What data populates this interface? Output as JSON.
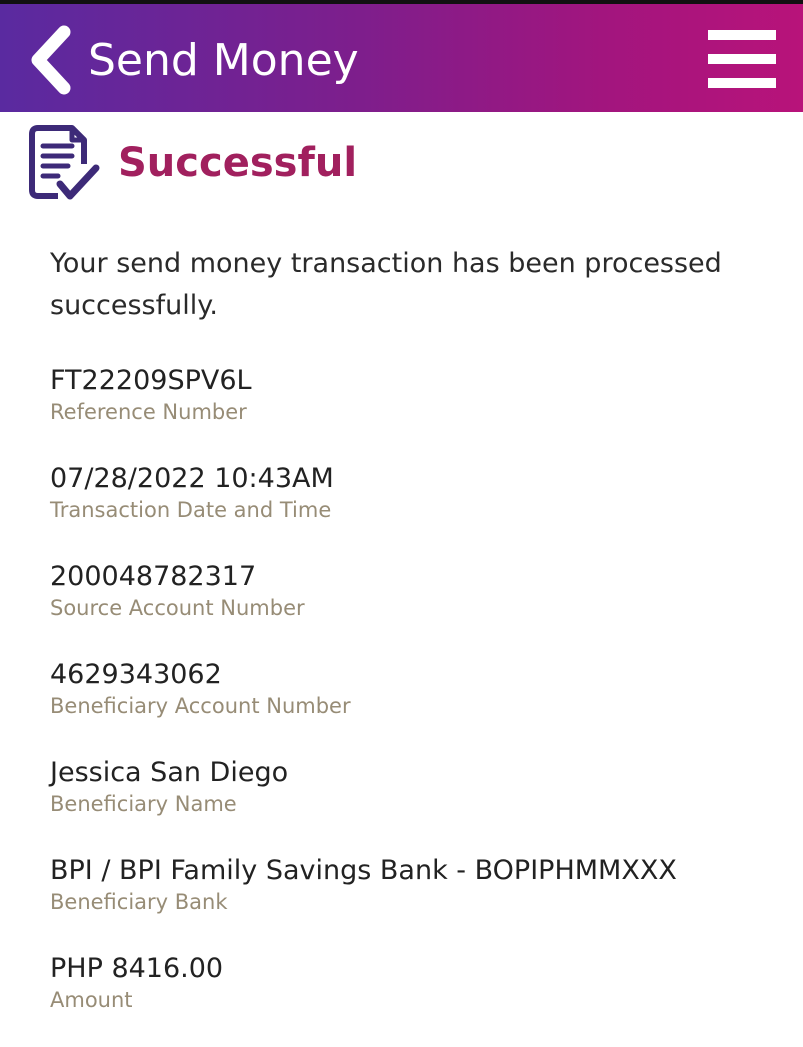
{
  "header": {
    "title": "Send Money",
    "back_icon": "chevron-left-icon",
    "menu_icon": "hamburger-menu-icon",
    "gradient_start": "#5a2aa0",
    "gradient_end": "#b8137a"
  },
  "status": {
    "icon": "receipt-check-icon",
    "title": "Successful",
    "title_color": "#a1205e",
    "message": "Your send money transaction has been processed successfully."
  },
  "details": [
    {
      "value": "FT22209SPV6L",
      "label": "Reference Number"
    },
    {
      "value": "07/28/2022 10:43AM",
      "label": "Transaction Date and Time"
    },
    {
      "value": "200048782317",
      "label": "Source Account Number"
    },
    {
      "value": "4629343062",
      "label": "Beneficiary Account Number"
    },
    {
      "value": "Jessica San Diego",
      "label": "Beneficiary Name"
    },
    {
      "value": "BPI / BPI Family Savings Bank - BOPIPHMMXXX",
      "label": "Beneficiary Bank"
    },
    {
      "value": "PHP 8416.00",
      "label": "Amount"
    }
  ]
}
